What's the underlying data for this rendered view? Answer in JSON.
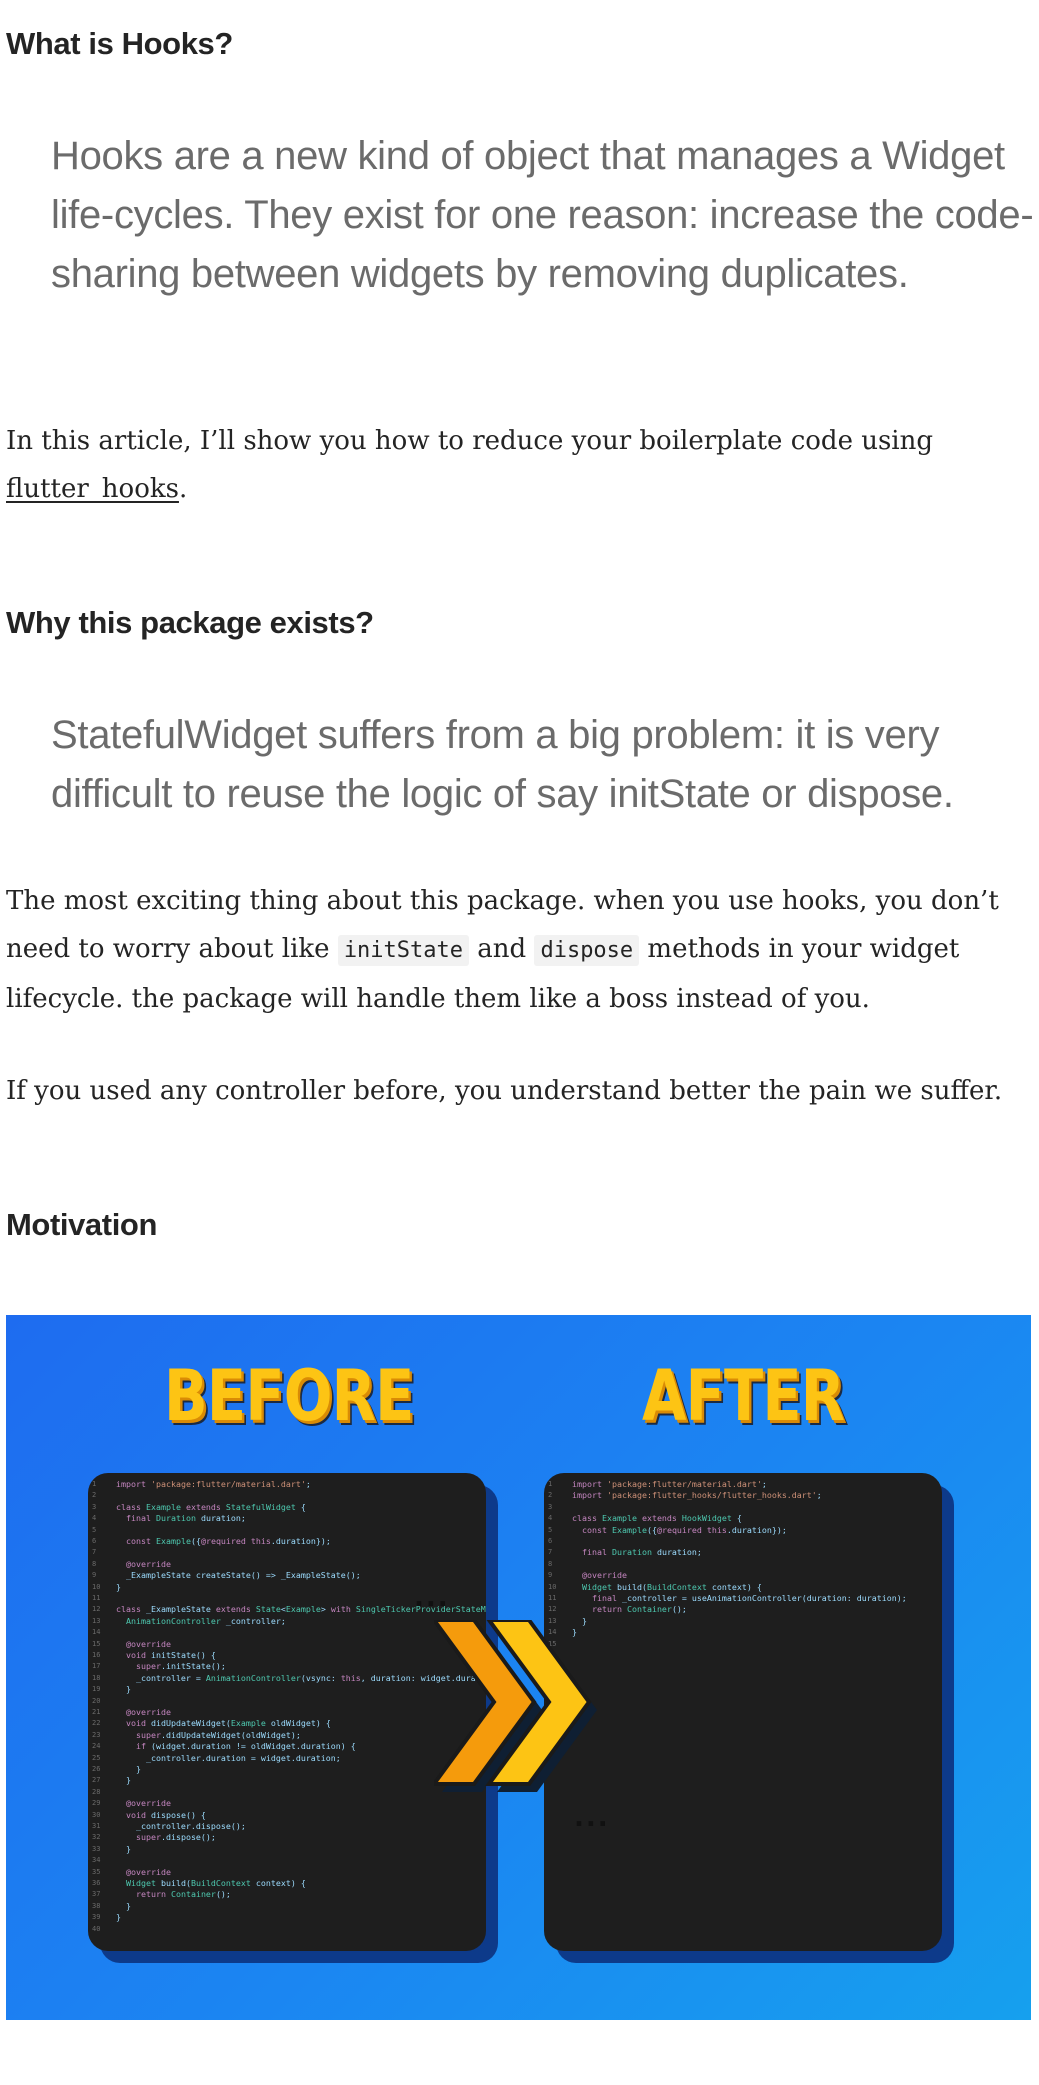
{
  "sections": {
    "what_heading": "What is Hooks?",
    "what_quote": "Hooks are a new kind of object that manages a Widget life-cycles. They exist for one reason: increase the code-sharing between widgets by removing duplicates.",
    "intro": {
      "text_before_link": "In this article, I’ll show you how to reduce your boilerplate code using ",
      "link_text": "flutter_hooks",
      "text_after_link": "."
    },
    "why_heading": "Why this package exists?",
    "why_quote": "StatefulWidget suffers from a big problem: it is very difficult to reuse the logic of say initState or dispose.",
    "exciting": {
      "part1": "The most exciting thing about this package. when you use hooks, you don’t need to worry about like ",
      "code1": "initState",
      "part2": " and ",
      "code2": "dispose",
      "part3": " methods in your widget lifecycle. the package will handle them like a boss instead of you."
    },
    "controller_para": "If you used any controller before, you understand better the pain we suffer.",
    "motivation_heading": "Motivation"
  },
  "figure": {
    "before_label": "BEFORE",
    "after_label": "AFTER",
    "dots_left": "...",
    "dots_right": "...",
    "before_code": [
      "import 'package:flutter/material.dart';",
      "",
      "class Example extends StatefulWidget {",
      "  final Duration duration;",
      "",
      "  const Example({@required this.duration});",
      "",
      "  @override",
      "  _ExampleState createState() => _ExampleState();",
      "}",
      "",
      "class _ExampleState extends State<Example> with SingleTickerProviderStateMixin {",
      "  AnimationController _controller;",
      "",
      "  @override",
      "  void initState() {",
      "    super.initState();",
      "    _controller = AnimationController(vsync: this, duration: widget.duration);",
      "  }",
      "",
      "  @override",
      "  void didUpdateWidget(Example oldWidget) {",
      "    super.didUpdateWidget(oldWidget);",
      "    if (widget.duration != oldWidget.duration) {",
      "      _controller.duration = widget.duration;",
      "    }",
      "  }",
      "",
      "  @override",
      "  void dispose() {",
      "    _controller.dispose();",
      "    super.dispose();",
      "  }",
      "",
      "  @override",
      "  Widget build(BuildContext context) {",
      "    return Container();",
      "  }",
      "}",
      ""
    ],
    "after_code": [
      "import 'package:flutter/material.dart';",
      "import 'package:flutter_hooks/flutter_hooks.dart';",
      "",
      "class Example extends HookWidget {",
      "  const Example({@required this.duration});",
      "",
      "  final Duration duration;",
      "",
      "  @override",
      "  Widget build(BuildContext context) {",
      "    final _controller = useAnimationController(duration: duration);",
      "    return Container();",
      "  }",
      "}",
      ""
    ],
    "colors": {
      "accent_yellow": "#fdc414",
      "keyword": "#c586c0",
      "type": "#4ec9b0",
      "string": "#ce9178"
    }
  }
}
